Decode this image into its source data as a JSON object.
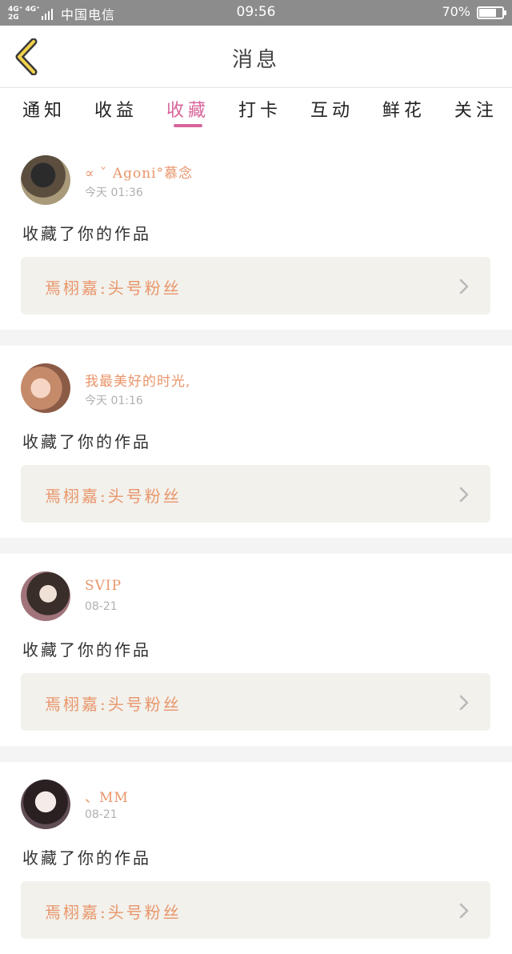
{
  "status_bar": {
    "network_top": "4G⁺ 4G⁺",
    "network_bottom": "2G",
    "carrier": "中国电信",
    "time": "09:56",
    "battery": "70%"
  },
  "header": {
    "title": "消息",
    "back_icon": "chevron-left-icon"
  },
  "tabs": [
    {
      "label": "通知",
      "active": false
    },
    {
      "label": "收益",
      "active": false
    },
    {
      "label": "收藏",
      "active": true
    },
    {
      "label": "打卡",
      "active": false
    },
    {
      "label": "互动",
      "active": false
    },
    {
      "label": "鲜花",
      "active": false
    },
    {
      "label": "关注",
      "active": false
    }
  ],
  "colors": {
    "accent": "#d9649a",
    "username": "#e9956a",
    "card_bg": "#f2f1ec"
  },
  "messages": [
    {
      "username": "∝ ˇ Agoni°慕念",
      "time": "今天 01:36",
      "action": "收藏了你的作品",
      "work_title": "焉栩嘉:头号粉丝"
    },
    {
      "username": "我最美好的时光,",
      "time": "今天 01:16",
      "action": "收藏了你的作品",
      "work_title": "焉栩嘉:头号粉丝"
    },
    {
      "username": "SVIP",
      "time": "08-21",
      "action": "收藏了你的作品",
      "work_title": "焉栩嘉:头号粉丝"
    },
    {
      "username": "、MM",
      "time": "08-21",
      "action": "收藏了你的作品",
      "work_title": "焉栩嘉:头号粉丝"
    }
  ]
}
